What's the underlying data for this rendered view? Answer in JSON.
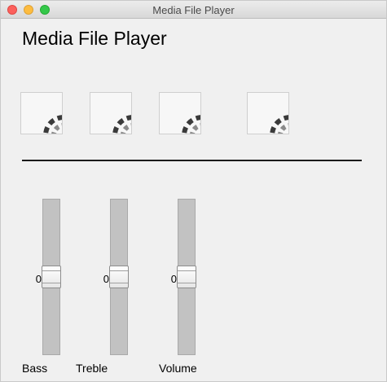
{
  "window": {
    "title": "Media File Player"
  },
  "app": {
    "title": "Media File Player"
  },
  "media_buttons": [
    {
      "icon": "loading-spinner-icon"
    },
    {
      "icon": "loading-spinner-icon"
    },
    {
      "icon": "loading-spinner-icon"
    },
    {
      "icon": "loading-spinner-icon"
    }
  ],
  "sliders": [
    {
      "label": "Bass",
      "value": "0"
    },
    {
      "label": "Treble",
      "value": "0"
    },
    {
      "label": "Volume",
      "value": "0"
    }
  ],
  "slider_level_fraction": 0.5
}
